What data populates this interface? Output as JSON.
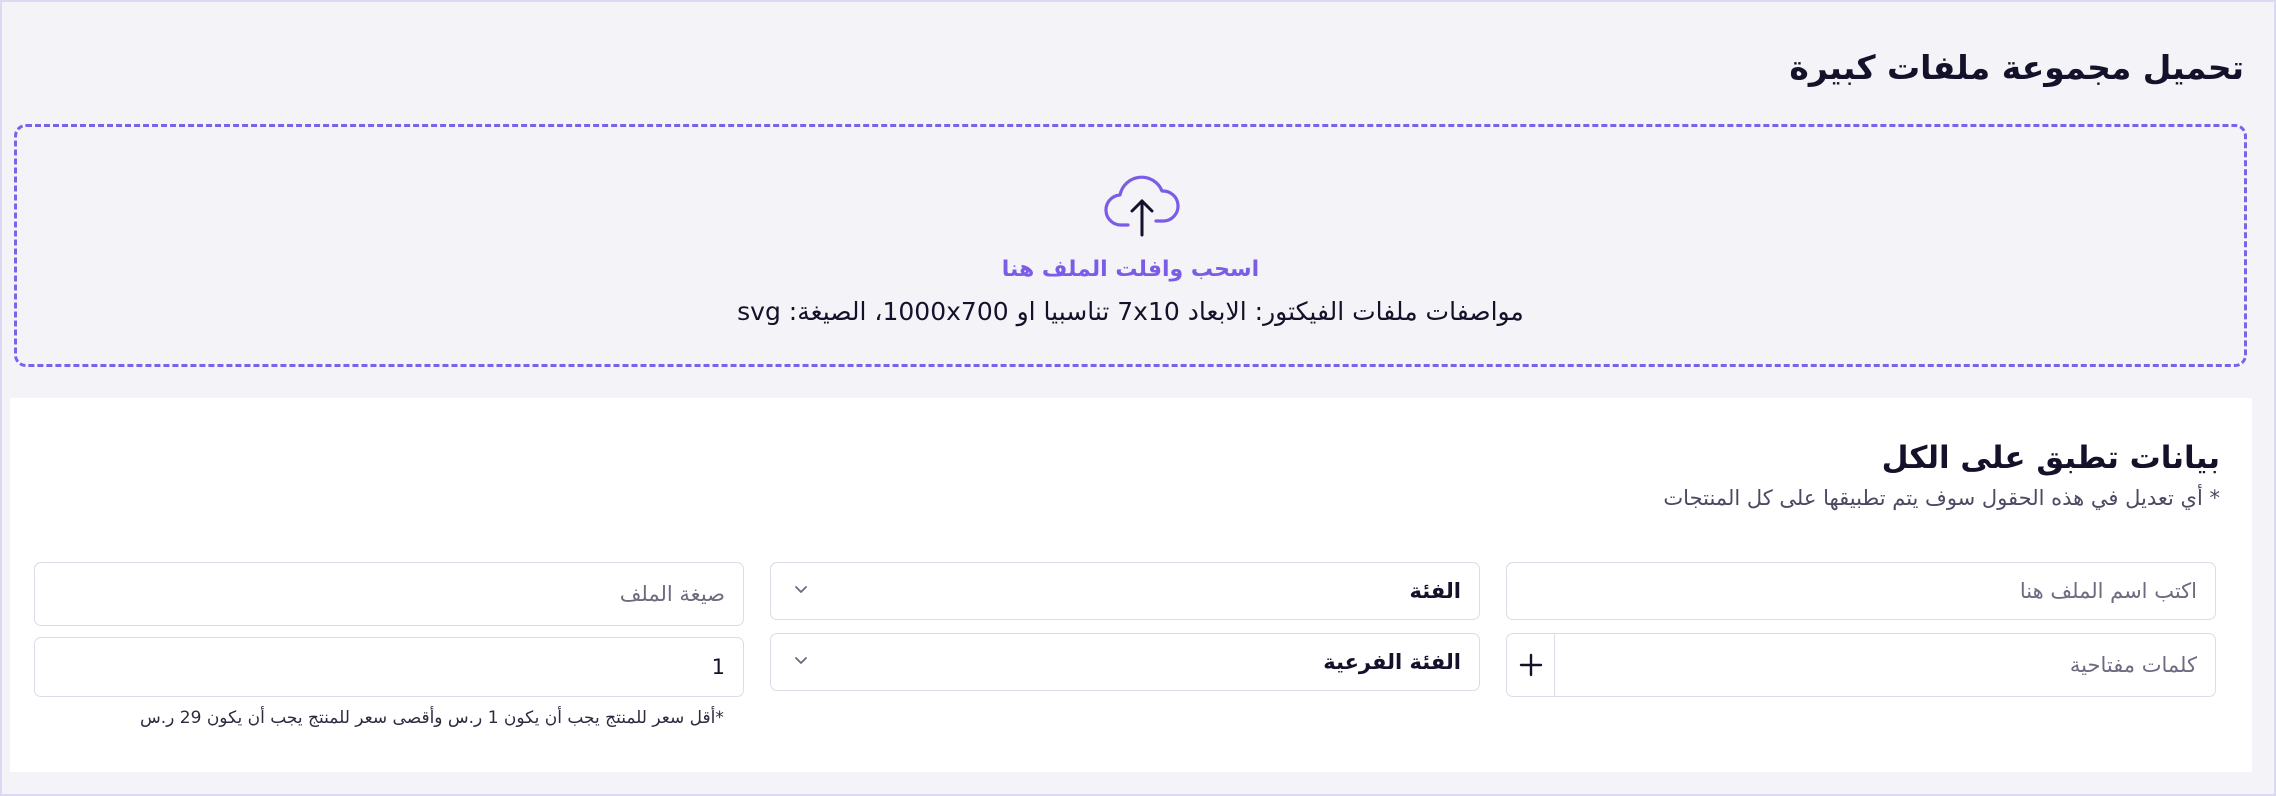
{
  "page": {
    "title": "تحميل مجموعة ملفات كبيرة"
  },
  "dropzone": {
    "icon": "cloud-upload-icon",
    "label": "اسحب وافلت الملف هنا",
    "spec": "مواصفات ملفات الفيكتور: الابعاد 7x10 تناسبيا او 1000x700، الصيغة: svg"
  },
  "shared_data": {
    "title": "بيانات تطبق على الكل",
    "note": "* أي تعديل في هذه الحقول سوف يتم تطبيقها على كل المنتجات"
  },
  "fields": {
    "file_name": {
      "placeholder": "اكتب اسم الملف هنا",
      "value": ""
    },
    "category": {
      "label": "الفئة",
      "icon": "chevron-down-icon"
    },
    "file_format": {
      "placeholder": "صيغة الملف",
      "value": ""
    },
    "keywords": {
      "placeholder": "كلمات مفتاحية",
      "value": "",
      "add_icon": "plus-icon"
    },
    "subcategory": {
      "label": "الفئة الفرعية",
      "icon": "chevron-down-icon"
    },
    "price": {
      "value": "1"
    },
    "price_note": "*أقل سعر للمنتج يجب أن يكون 1 ر.س وأقصى سعر للمنتج يجب أن يكون 29 ر.س"
  },
  "colors": {
    "accent": "#7b5ce6",
    "background": "#f4f3f8",
    "card": "#ffffff",
    "border": "#dcdbe6"
  }
}
